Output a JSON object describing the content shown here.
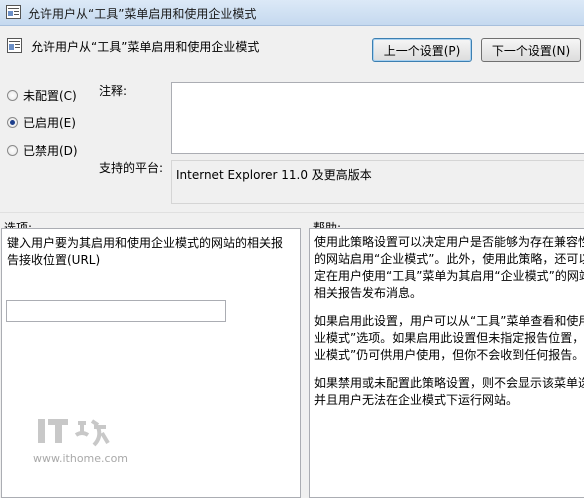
{
  "window": {
    "title": "允许用户从“工具”菜单启用和使用企业模式"
  },
  "header": {
    "policy_title": "允许用户从“工具”菜单启用和使用企业模式"
  },
  "buttons": {
    "prev": "上一个设置(P)",
    "next": "下一个设置(N)"
  },
  "state": {
    "options": [
      {
        "label": "未配置(C)",
        "selected": false
      },
      {
        "label": "已启用(E)",
        "selected": true
      },
      {
        "label": "已禁用(D)",
        "selected": false
      }
    ]
  },
  "comment": {
    "label": "注释:",
    "value": ""
  },
  "platform": {
    "label": "支持的平台:",
    "value": "Internet Explorer 11.0 及更高版本"
  },
  "options_section": {
    "label": "选项:",
    "description": "键入用户要为其启用和使用企业模式的网站的相关报告接收位置(URL)",
    "url_value": ""
  },
  "help_section": {
    "label": "帮助:",
    "paragraphs": [
      "使用此策略设置可以决定用户是否能够为存在兼容性问题的网站启用“企业模式”。此外，使用此策略，还可以指定在用户使用“工具”菜单为其启用“企业模式”的网站的相关报告发布消息。",
      "如果启用此设置，用户可以从“工具”菜单查看和使用“企业模式”选项。如果启用此设置但未指定报告位置，“企业模式”仍可供用户使用，但你不会收到任何报告。",
      "如果禁用或未配置此策略设置，则不会显示该菜单选项，并且用户无法在企业模式下运行网站。"
    ]
  },
  "watermark": {
    "logo_text": "IT之家",
    "url": "www.ithome.com"
  }
}
